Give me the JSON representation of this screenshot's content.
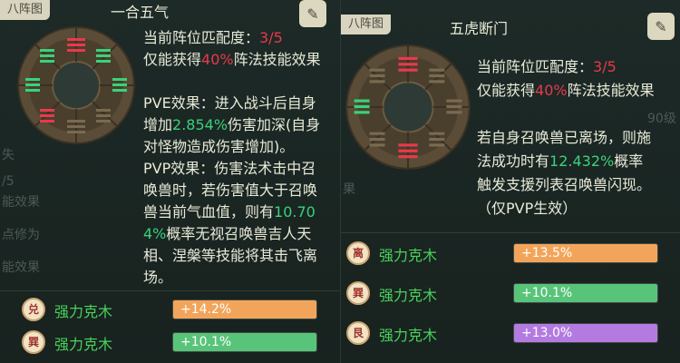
{
  "colors": {
    "red": "#e8394c",
    "green": "#39d27a",
    "bar_orange": "#f2a55a",
    "bar_green": "#58c47a",
    "bar_purple": "#b37be0"
  },
  "left": {
    "tab": "八阵图",
    "title": "一合五气",
    "corner_icon": "edit-pencil-icon",
    "match_label": "当前阵位匹配度：",
    "match_value": "3/5",
    "effect_prefix": "仅能获得",
    "effect_pct": "40%",
    "effect_suffix": "阵法技能效果",
    "pve_line1": "PVE效果：进入战斗后自身",
    "pve_line2_a": "增加",
    "pve_line2_val": "2.854%",
    "pve_line2_b": "伤害加深(自身",
    "pve_line3": "对怪物造成伤害增加)。",
    "pvp_line1": "PVP效果：伤害法术击中召",
    "pvp_line2": "唤兽时，若伤害值大于召唤",
    "pvp_line3_a": "兽当前气血值，则有",
    "pvp_line3_val": "10.70",
    "pvp_line4_val": "4%",
    "pvp_line4_b": "概率无视召唤兽吉人天",
    "pvp_line5": "相、涅槃等技能将其击飞离",
    "pvp_line6": "场。",
    "bg_texts": [
      "失",
      "/5",
      "能效果",
      "点修为",
      "能效果"
    ],
    "rows": [
      {
        "badge": "兑",
        "name": "强力克木",
        "value": "+14.2%",
        "fill_pct": 100,
        "color": "#f2a55a"
      },
      {
        "badge": "巽",
        "name": "强力克木",
        "value": "+10.1%",
        "fill_pct": 100,
        "color": "#58c47a"
      }
    ]
  },
  "right": {
    "tab": "八阵图",
    "title": "五虎断门",
    "corner_icon": "edit-pencil-icon",
    "match_label": "当前阵位匹配度：",
    "match_value": "3/5",
    "effect_prefix": "仅能获得",
    "effect_pct": "40%",
    "effect_suffix": "阵法技能效果",
    "desc_line1": "若自身召唤兽已离场，则施",
    "desc_line2_a": "法成功时有",
    "desc_line2_val": "12.432%",
    "desc_line2_b": "概率",
    "desc_line3": "触发支援列表召唤兽闪现。",
    "desc_line4": "（仅PVP生效）",
    "bg_texts": [
      "果",
      "90级"
    ],
    "rows": [
      {
        "badge": "离",
        "name": "强力克木",
        "value": "+13.5%",
        "fill_pct": 100,
        "color": "#f2a55a"
      },
      {
        "badge": "巽",
        "name": "强力克木",
        "value": "+10.1%",
        "fill_pct": 100,
        "color": "#58c47a"
      },
      {
        "badge": "艮",
        "name": "强力克木",
        "value": "+13.0%",
        "fill_pct": 100,
        "color": "#b37be0"
      }
    ]
  }
}
